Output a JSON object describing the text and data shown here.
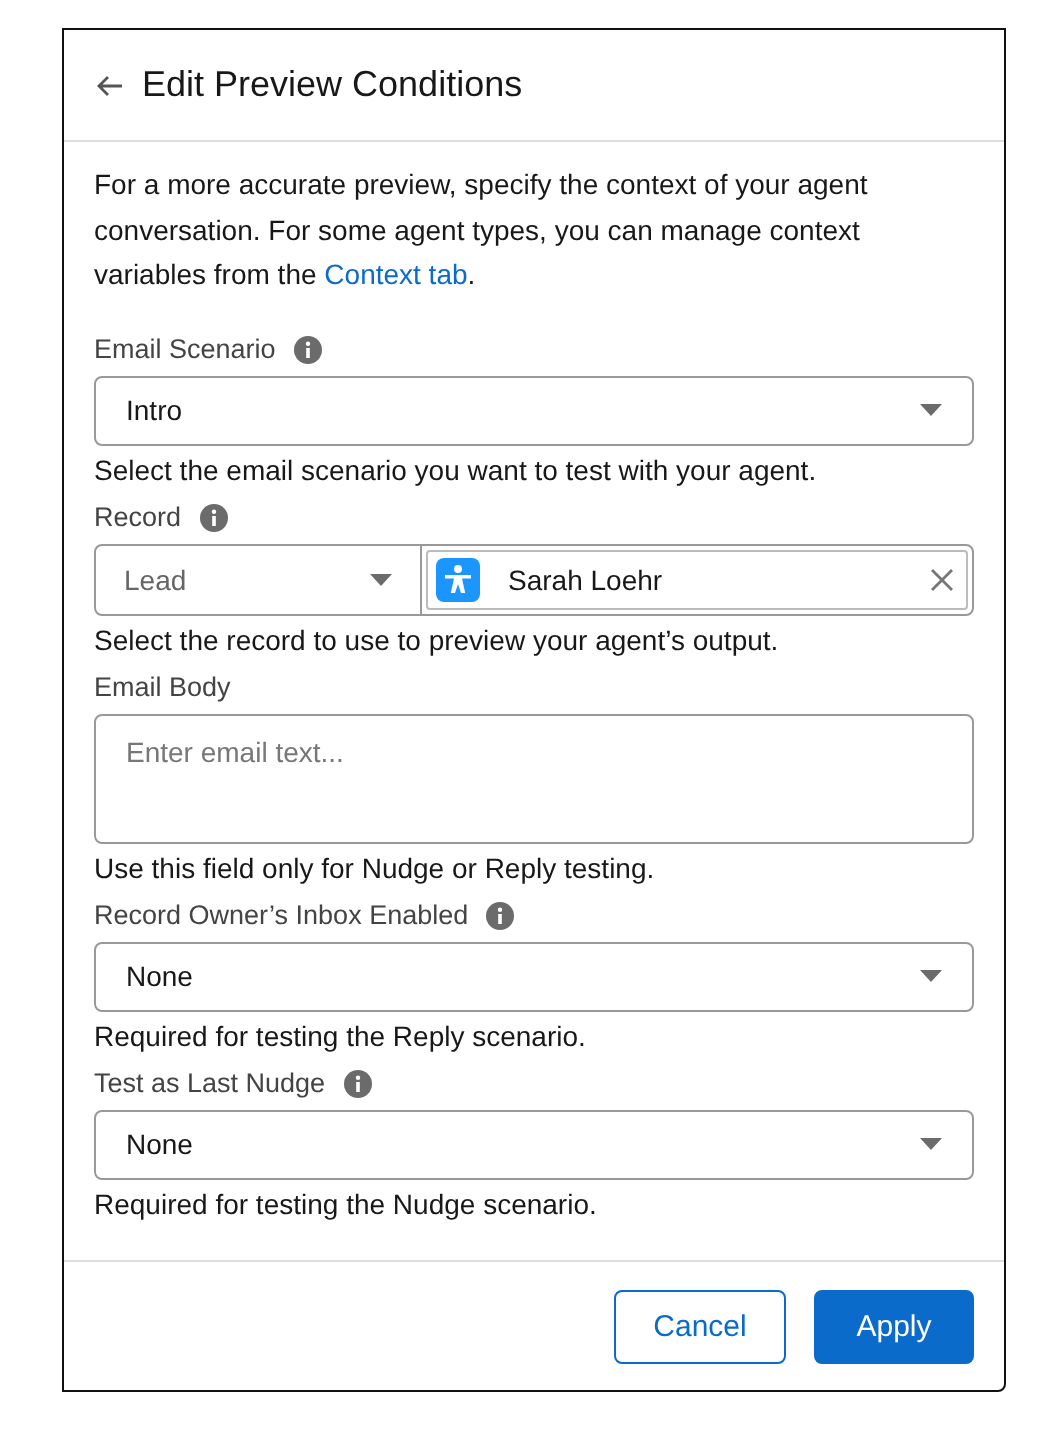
{
  "header": {
    "title": "Edit Preview Conditions"
  },
  "description": {
    "text": "For a more accurate preview, specify the context of your agent conversation. For some agent types, you can manage context variables from the ",
    "link": "Context tab",
    "after": "."
  },
  "fields": [
    {
      "kind": "select",
      "label": "Email Scenario",
      "info": true,
      "value": "Intro",
      "help": "Select the email scenario you want to test with your agent."
    },
    {
      "kind": "lookup",
      "label": "Record",
      "info": true,
      "object": "Lead",
      "value": "Sarah Loehr",
      "help": "Select the record to use to preview your agent’s output."
    },
    {
      "kind": "textarea",
      "label": "Email Body",
      "info": false,
      "placeholder": "Enter email text...",
      "help": "Use this field only for Nudge or Reply testing."
    },
    {
      "kind": "select",
      "label": "Record Owner’s Inbox Enabled",
      "info": true,
      "value": "None",
      "help": "Required for testing the Reply scenario."
    },
    {
      "kind": "select",
      "label": "Test as Last Nudge",
      "info": true,
      "value": "None",
      "help": "Required for testing the Nudge scenario."
    }
  ],
  "buttons": [
    {
      "label": "Cancel",
      "kind": "secondary"
    },
    {
      "label": "Apply",
      "kind": "primary"
    }
  ]
}
